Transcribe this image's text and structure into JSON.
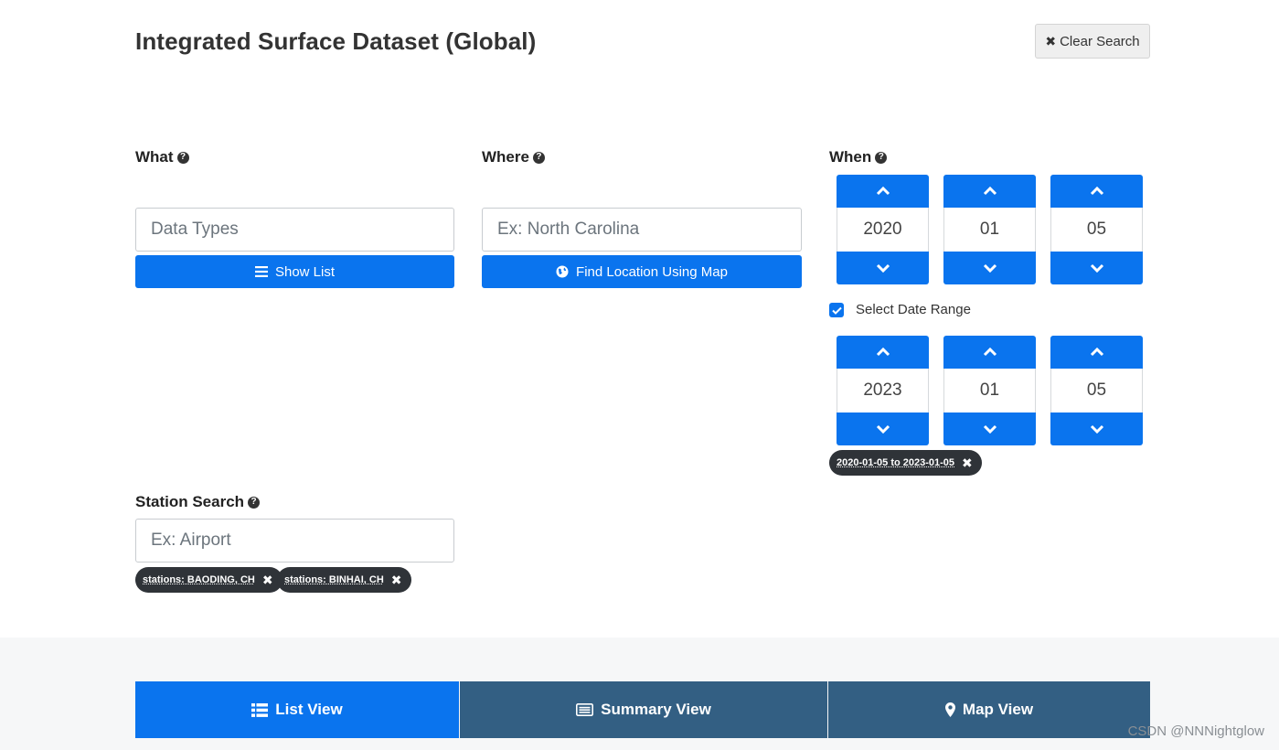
{
  "header": {
    "title": "Integrated Surface Dataset (Global)",
    "clear_search_label": "Clear Search"
  },
  "what": {
    "label": "What",
    "input_placeholder": "Data Types",
    "show_list_label": "Show List"
  },
  "where": {
    "label": "Where",
    "input_placeholder": "Ex: North Carolina",
    "find_location_label": "Find Location Using Map"
  },
  "when": {
    "label": "When",
    "start": {
      "year": "2020",
      "month": "01",
      "day": "05"
    },
    "range_checkbox_label": "Select Date Range",
    "range_checked": true,
    "end": {
      "year": "2023",
      "month": "01",
      "day": "05"
    },
    "range_pill": "2020-01-05 to 2023-01-05"
  },
  "station_search": {
    "label": "Station Search",
    "input_placeholder": "Ex: Airport",
    "pills": [
      "stations: BAODING, CH",
      "stations: BINHAI, CH"
    ]
  },
  "views": {
    "list_label": "List View",
    "summary_label": "Summary View",
    "map_label": "Map View",
    "active": "list"
  },
  "watermark": "CSDN @NNNightglow",
  "colors": {
    "primary": "#0a74ee",
    "tab_inactive": "#335f83",
    "pill_bg": "#2f3338"
  }
}
